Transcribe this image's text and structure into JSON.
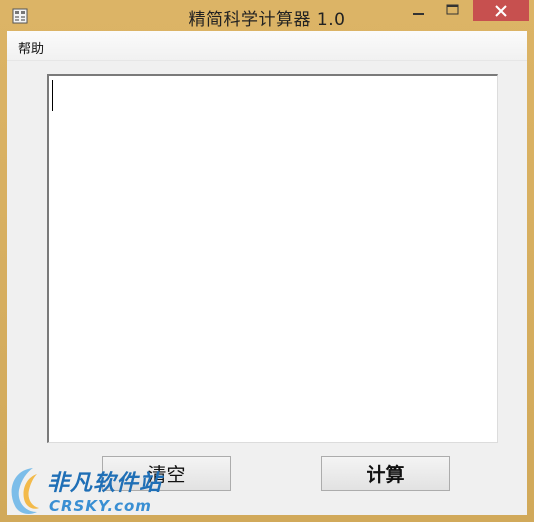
{
  "window": {
    "title": "精简科学计算器 1.0"
  },
  "menu": {
    "items": [
      {
        "label": "帮助"
      }
    ]
  },
  "textarea": {
    "value": ""
  },
  "buttons": {
    "clear_label": "清空",
    "calc_label": "计算"
  },
  "watermark": {
    "line1": "非凡软件站",
    "line2": "CRSKY.com"
  },
  "colors": {
    "titlebar": "#d6ad5f",
    "close": "#c7504f",
    "client": "#f0f0f0",
    "watermark": "#1f6fb6"
  },
  "icons": {
    "app": "calculator-icon",
    "minimize": "minimize-icon",
    "maximize": "maximize-icon",
    "close": "close-icon",
    "logo": "crsky-logo-icon"
  }
}
